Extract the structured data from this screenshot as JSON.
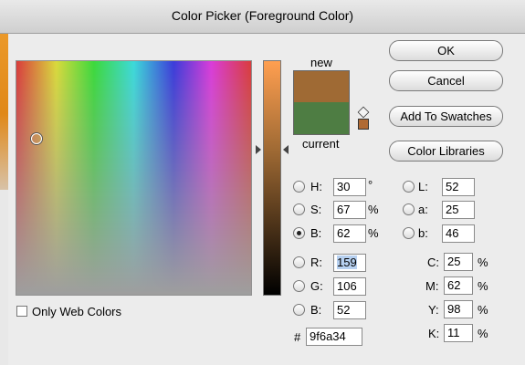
{
  "window": {
    "title": "Color Picker (Foreground Color)"
  },
  "preview": {
    "new_label": "new",
    "current_label": "current",
    "new_color": "#9f6a34",
    "current_color": "#4e7d43"
  },
  "buttons": {
    "ok": "OK",
    "cancel": "Cancel",
    "add_to_swatches": "Add To Swatches",
    "color_libraries": "Color Libraries"
  },
  "hsb": {
    "h": {
      "label": "H:",
      "value": "30",
      "unit": "°"
    },
    "s": {
      "label": "S:",
      "value": "67",
      "unit": "%"
    },
    "b": {
      "label": "B:",
      "value": "62",
      "unit": "%",
      "selected": true
    }
  },
  "rgb": {
    "r": {
      "label": "R:",
      "value": "159"
    },
    "g": {
      "label": "G:",
      "value": "106"
    },
    "b": {
      "label": "B:",
      "value": "52"
    }
  },
  "lab": {
    "l": {
      "label": "L:",
      "value": "52"
    },
    "a": {
      "label": "a:",
      "value": "25"
    },
    "b": {
      "label": "b:",
      "value": "46"
    }
  },
  "cmyk": {
    "c": {
      "label": "C:",
      "value": "25",
      "unit": "%"
    },
    "m": {
      "label": "M:",
      "value": "62",
      "unit": "%"
    },
    "y": {
      "label": "Y:",
      "value": "98",
      "unit": "%"
    },
    "k": {
      "label": "K:",
      "value": "11",
      "unit": "%"
    }
  },
  "hex": {
    "label": "#",
    "value": "9f6a34"
  },
  "only_web_colors": {
    "label": "Only Web Colors",
    "checked": false
  }
}
